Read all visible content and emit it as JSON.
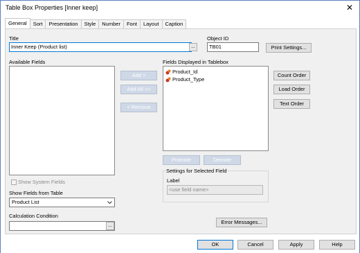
{
  "window": {
    "title": "Table Box Properties [Inner keep]",
    "close_glyph": "✕"
  },
  "tabs": [
    {
      "label": "General",
      "active": true
    },
    {
      "label": "Sort"
    },
    {
      "label": "Presentation"
    },
    {
      "label": "Style"
    },
    {
      "label": "Number"
    },
    {
      "label": "Font"
    },
    {
      "label": "Layout"
    },
    {
      "label": "Caption"
    }
  ],
  "general": {
    "title_label": "Title",
    "title_value": "Inner Keep (Product list)",
    "title_ellipsis": "...",
    "object_id_label": "Object ID",
    "object_id_value": "TB01",
    "print_settings": "Print Settings...",
    "available_fields_label": "Available Fields",
    "fields_displayed_label": "Fields Displayed in Tablebox",
    "fields_displayed": [
      "Product_Id",
      "Product_Type"
    ],
    "add_button": "Add >",
    "add_all_button": "Add All >>",
    "remove_button": "< Remove",
    "count_order_button": "Count Order",
    "load_order_button": "Load Order",
    "text_order_button": "Text Order",
    "promote_button": "Promote",
    "demote_button": "Demote",
    "settings_group_label": "Settings for Selected Field",
    "label_label": "Label",
    "label_placeholder": "<use field name>",
    "show_system_fields": "Show System Fields",
    "show_fields_from_table_label": "Show Fields from Table",
    "show_fields_from_table_value": "Product List",
    "calculation_condition_label": "Calculation Condition",
    "calc_ellipsis": "...",
    "error_messages_button": "Error Messages..."
  },
  "footer": {
    "ok": "OK",
    "cancel": "Cancel",
    "apply": "Apply",
    "help": "Help"
  },
  "colors": {
    "accent": "#0078d7",
    "disabled_button": "#cfd8e6"
  }
}
